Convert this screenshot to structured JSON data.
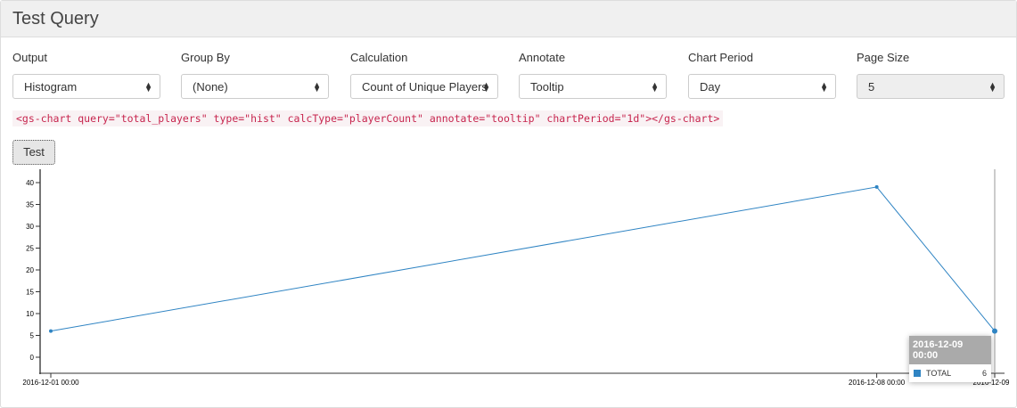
{
  "title": "Test Query",
  "fields": [
    {
      "label": "Output",
      "value": "Histogram",
      "disabled": false
    },
    {
      "label": "Group By",
      "value": "(None)",
      "disabled": false
    },
    {
      "label": "Calculation",
      "value": "Count of Unique Players",
      "disabled": false
    },
    {
      "label": "Annotate",
      "value": "Tooltip",
      "disabled": false
    },
    {
      "label": "Chart Period",
      "value": "Day",
      "disabled": false
    },
    {
      "label": "Page Size",
      "value": "5",
      "disabled": true
    }
  ],
  "code": "<gs-chart query=\"total_players\" type=\"hist\" calcType=\"playerCount\" annotate=\"tooltip\" chartPeriod=\"1d\"></gs-chart>",
  "test_label": "Test",
  "tooltip": {
    "title": "2016-12-09 00:00",
    "series": "TOTAL",
    "value": "6"
  },
  "chart_data": {
    "type": "line",
    "x": [
      "2016-12-01 00:00",
      "2016-12-08 00:00",
      "2016-12-09"
    ],
    "x_days": [
      0,
      7,
      8
    ],
    "series": [
      {
        "name": "TOTAL",
        "values": [
          6,
          39,
          6
        ],
        "color": "#2f84c3"
      }
    ],
    "yticks": [
      0,
      5,
      10,
      15,
      20,
      25,
      30,
      35,
      40
    ],
    "ylim": [
      -4,
      43
    ]
  }
}
